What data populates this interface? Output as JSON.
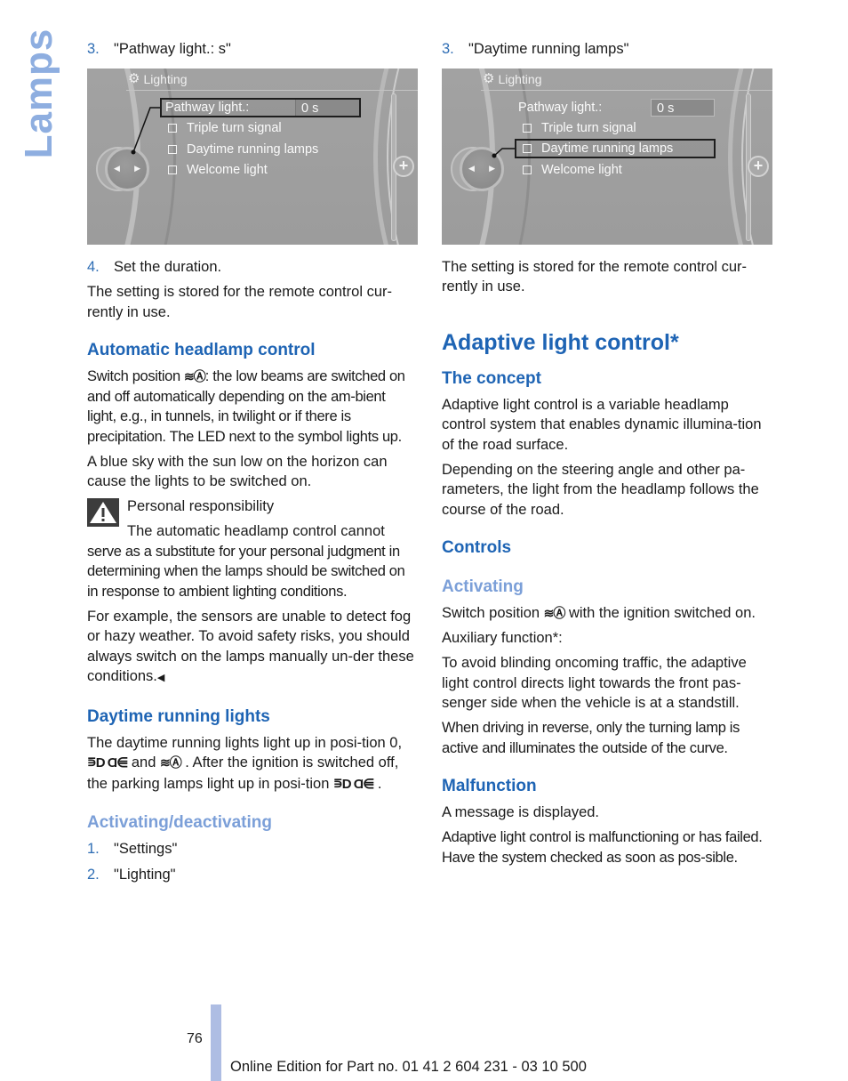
{
  "side_tab": {
    "label": "Lamps"
  },
  "left_column": {
    "step3": {
      "num": "3.",
      "text": "\"Pathway light.: s\""
    },
    "screen": {
      "title": "Lighting",
      "rows": [
        {
          "label": "Pathway light.:",
          "value": "0 s",
          "checkbox": false,
          "selected": true
        },
        {
          "label": "Triple turn signal",
          "checkbox": true,
          "selected": false
        },
        {
          "label": "Daytime running lamps",
          "checkbox": true,
          "selected": false
        },
        {
          "label": "Welcome light",
          "checkbox": true,
          "selected": false
        }
      ]
    },
    "step4": {
      "num": "4.",
      "text": "Set the duration."
    },
    "stored_note": "The setting is stored for the remote control cur-rently in use.",
    "auto_headlamp": {
      "heading": "Automatic headlamp control",
      "para1_pre": "Switch position ",
      "para1_post": ": the low beams are switched on and off automatically depending on the am-bient light, e.g., in tunnels, in twilight or if there is precipitation. The LED next to the symbol lights up.",
      "para2": "A blue sky with the sun low on the horizon can cause the lights to be switched on.",
      "warning_title": "Personal responsibility",
      "warning_line1": "The automatic headlamp control cannot",
      "warning_rest": "serve as a substitute for your personal judgment in determining when the lamps should be switched on in response to ambient lighting conditions.",
      "para3": "For example, the sensors are unable to detect fog or hazy weather. To avoid safety risks, you should always switch on the lamps manually un-der these conditions.",
      "end_mark": "◀"
    },
    "daytime": {
      "heading": "Daytime running lights",
      "part1": "The daytime running lights light up in posi-tion 0, ",
      "part2": " and ",
      "part3": " . After the ignition is switched off, the parking lamps light up in posi-tion ",
      "part4": " ."
    },
    "activating_deactivating": {
      "heading": "Activating/deactivating",
      "steps": [
        {
          "num": "1.",
          "text": "\"Settings\""
        },
        {
          "num": "2.",
          "text": "\"Lighting\""
        }
      ]
    }
  },
  "right_column": {
    "step3": {
      "num": "3.",
      "text": "\"Daytime running lamps\""
    },
    "screen": {
      "title": "Lighting",
      "rows": [
        {
          "label": "Pathway light.:",
          "value": "0 s",
          "checkbox": false,
          "selected": false
        },
        {
          "label": "Triple turn signal",
          "checkbox": true,
          "selected": false
        },
        {
          "label": "Daytime running lamps",
          "checkbox": true,
          "selected": true
        },
        {
          "label": "Welcome light",
          "checkbox": true,
          "selected": false
        }
      ]
    },
    "stored_note": "The setting is stored for the remote control cur-rently in use.",
    "adaptive": {
      "title": "Adaptive light control*",
      "concept_heading": "The concept",
      "concept_p1": "Adaptive light control is a variable headlamp control system that enables dynamic illumina-tion of the road surface.",
      "concept_p2": "Depending on the steering angle and other pa-rameters, the light from the headlamp follows the course of the road.",
      "controls_heading": "Controls",
      "activating_heading": "Activating",
      "activating_pre": "Switch position ",
      "activating_post": " with the ignition switched on.",
      "aux_label": "Auxiliary function*:",
      "aux_p1": "To avoid blinding oncoming traffic, the adaptive light control directs light towards the front pas-senger side when the vehicle is at a standstill.",
      "aux_p2": "When driving in reverse, only the turning lamp is active and illuminates the outside of the curve.",
      "malfunction_heading": "Malfunction",
      "malfunction_p1": "A message is displayed.",
      "malfunction_p2": "Adaptive light control is malfunctioning or has failed. Have the system checked as soon as pos-sible."
    }
  },
  "symbols": {
    "auto_light": "≋Ⓐ",
    "parking_lights": "⋾D Ɑ⋹"
  },
  "footer": {
    "page_number": "76",
    "edition": "Online Edition for Part no. 01 41 2 604 231 - 03 10 500"
  },
  "colors": {
    "heading_blue": "#1e64b4",
    "subheading_light_blue": "#7b9fd8",
    "side_tab": "#8eaee0",
    "footer_bar": "#aebde3"
  }
}
